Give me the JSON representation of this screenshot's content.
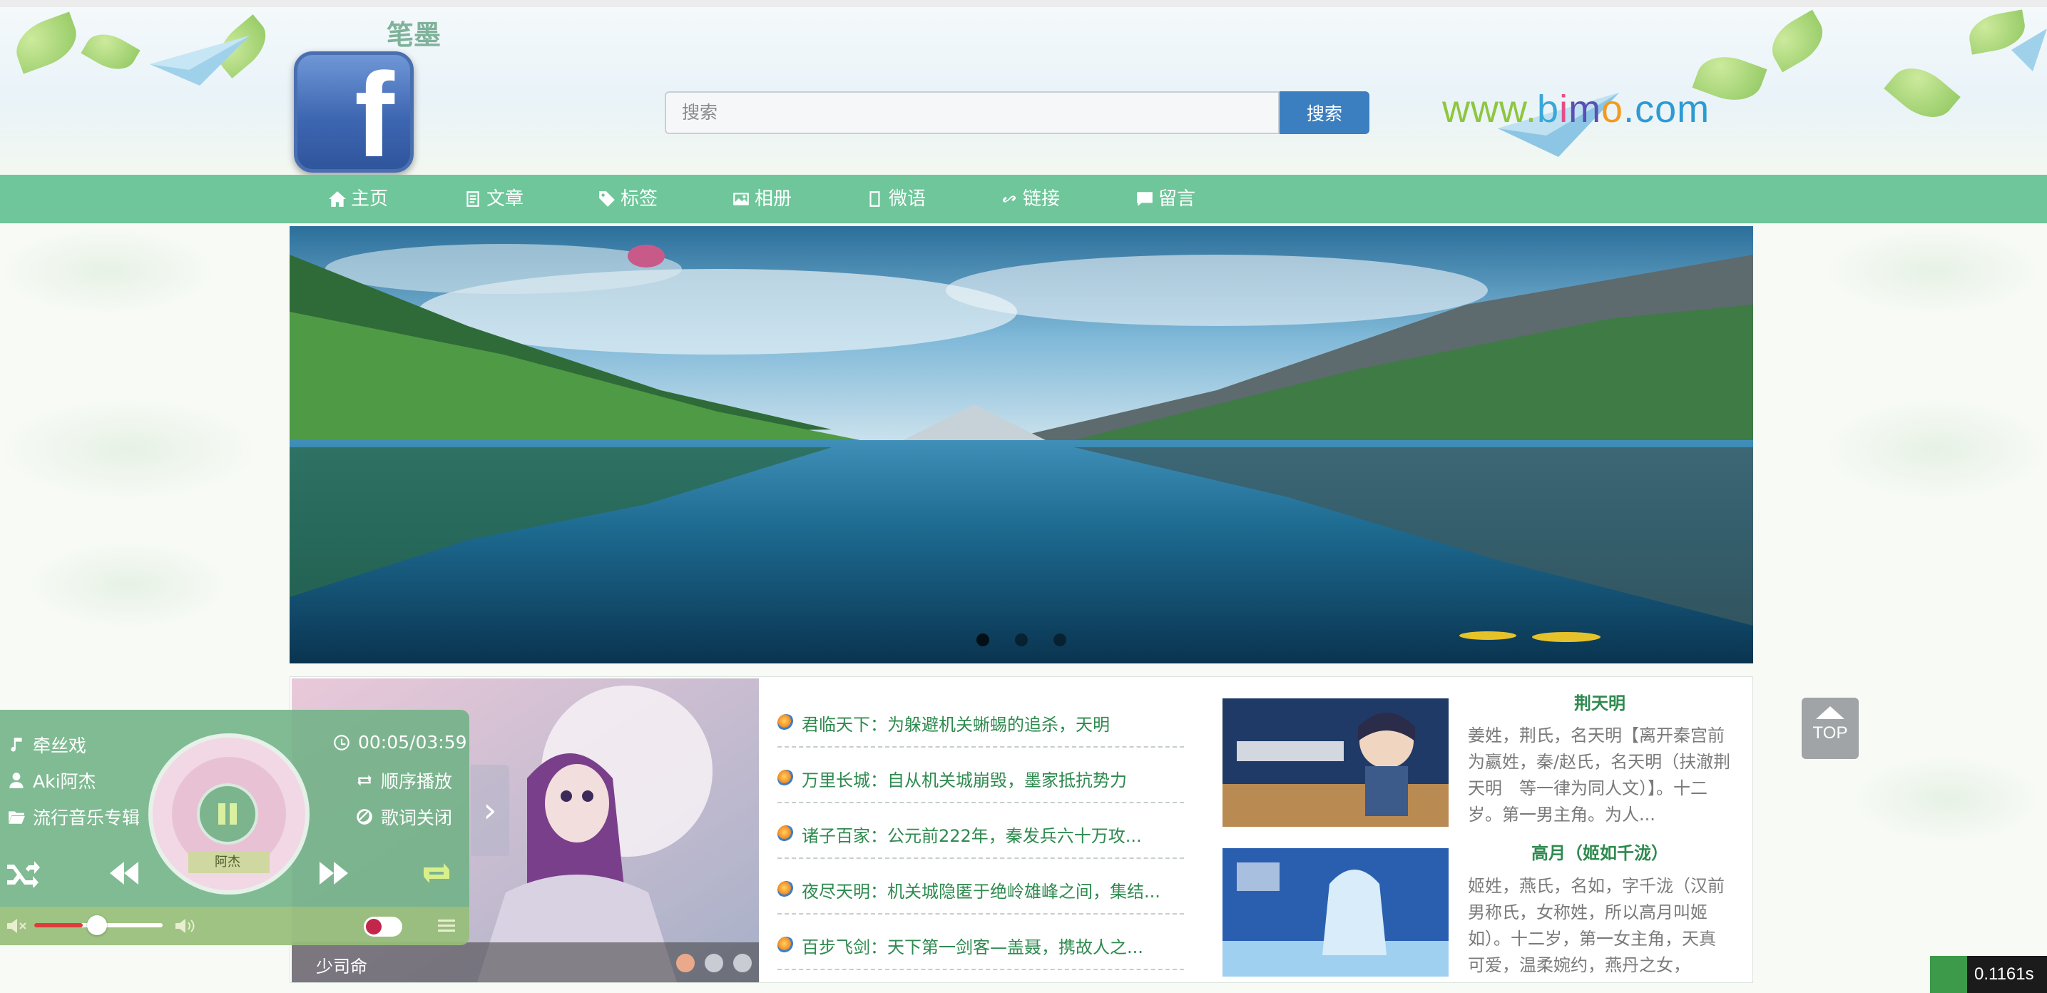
{
  "header": {
    "site_title": "笔墨",
    "logo_letter": "f",
    "search": {
      "placeholder": "搜索",
      "button_label": "搜索"
    },
    "brand": [
      "www.",
      "b",
      "i",
      "m",
      "o",
      ".com"
    ]
  },
  "nav": {
    "items": [
      {
        "label": "主页",
        "icon": "home-icon"
      },
      {
        "label": "文章",
        "icon": "article-icon"
      },
      {
        "label": "标签",
        "icon": "tag-icon"
      },
      {
        "label": "相册",
        "icon": "photo-icon"
      },
      {
        "label": "微语",
        "icon": "book-icon"
      },
      {
        "label": "链接",
        "icon": "link-icon"
      },
      {
        "label": "留言",
        "icon": "comment-icon"
      }
    ]
  },
  "banner": {
    "slide_count": 3,
    "active_slide": 1
  },
  "featured": {
    "caption": "少司命",
    "dot_count": 3,
    "active_dot": 1,
    "arrow": "›"
  },
  "news": [
    "君临天下：为躲避机关蜥蜴的追杀，天明",
    "万里长城：自从机关城崩毁，墨家抵抗势力",
    "诸子百家：公元前222年，秦发兵六十万攻...",
    "夜尽天明：机关城隐匿于绝岭雄峰之间，集结...",
    "百步飞剑：天下第一剑客—盖聂，携故人之..."
  ],
  "cards": [
    {
      "title": "荆天明",
      "text": "姜姓，荆氏，名天明【离开秦宫前为嬴姓，秦/赵氏，名天明（扶澈荆天明　等一律为同人文）】。十二岁。第一男主角。为人..."
    },
    {
      "title": "高月（姬如千泷）",
      "text": "姬姓，燕氏，名如，字千泷（汉前男称氏，女称姓，所以高月叫姬如）。十二岁，第一女主角，天真可爱，温柔婉约，燕丹之女，"
    }
  ],
  "player": {
    "song": "牵丝戏",
    "artist": "Aki阿杰",
    "album": "流行音乐专辑",
    "time": "00:05/03:59",
    "play_mode": "顺序播放",
    "lyrics_status": "歌词关闭",
    "volume_percent": 38,
    "disc_label": "阿杰"
  },
  "top_button": {
    "label": "TOP"
  },
  "timer": {
    "value": "0.1161s"
  },
  "colors": {
    "nav": "#6ec69a",
    "accent_green": "#2e8a4f",
    "search_button": "#3b7fc0"
  }
}
